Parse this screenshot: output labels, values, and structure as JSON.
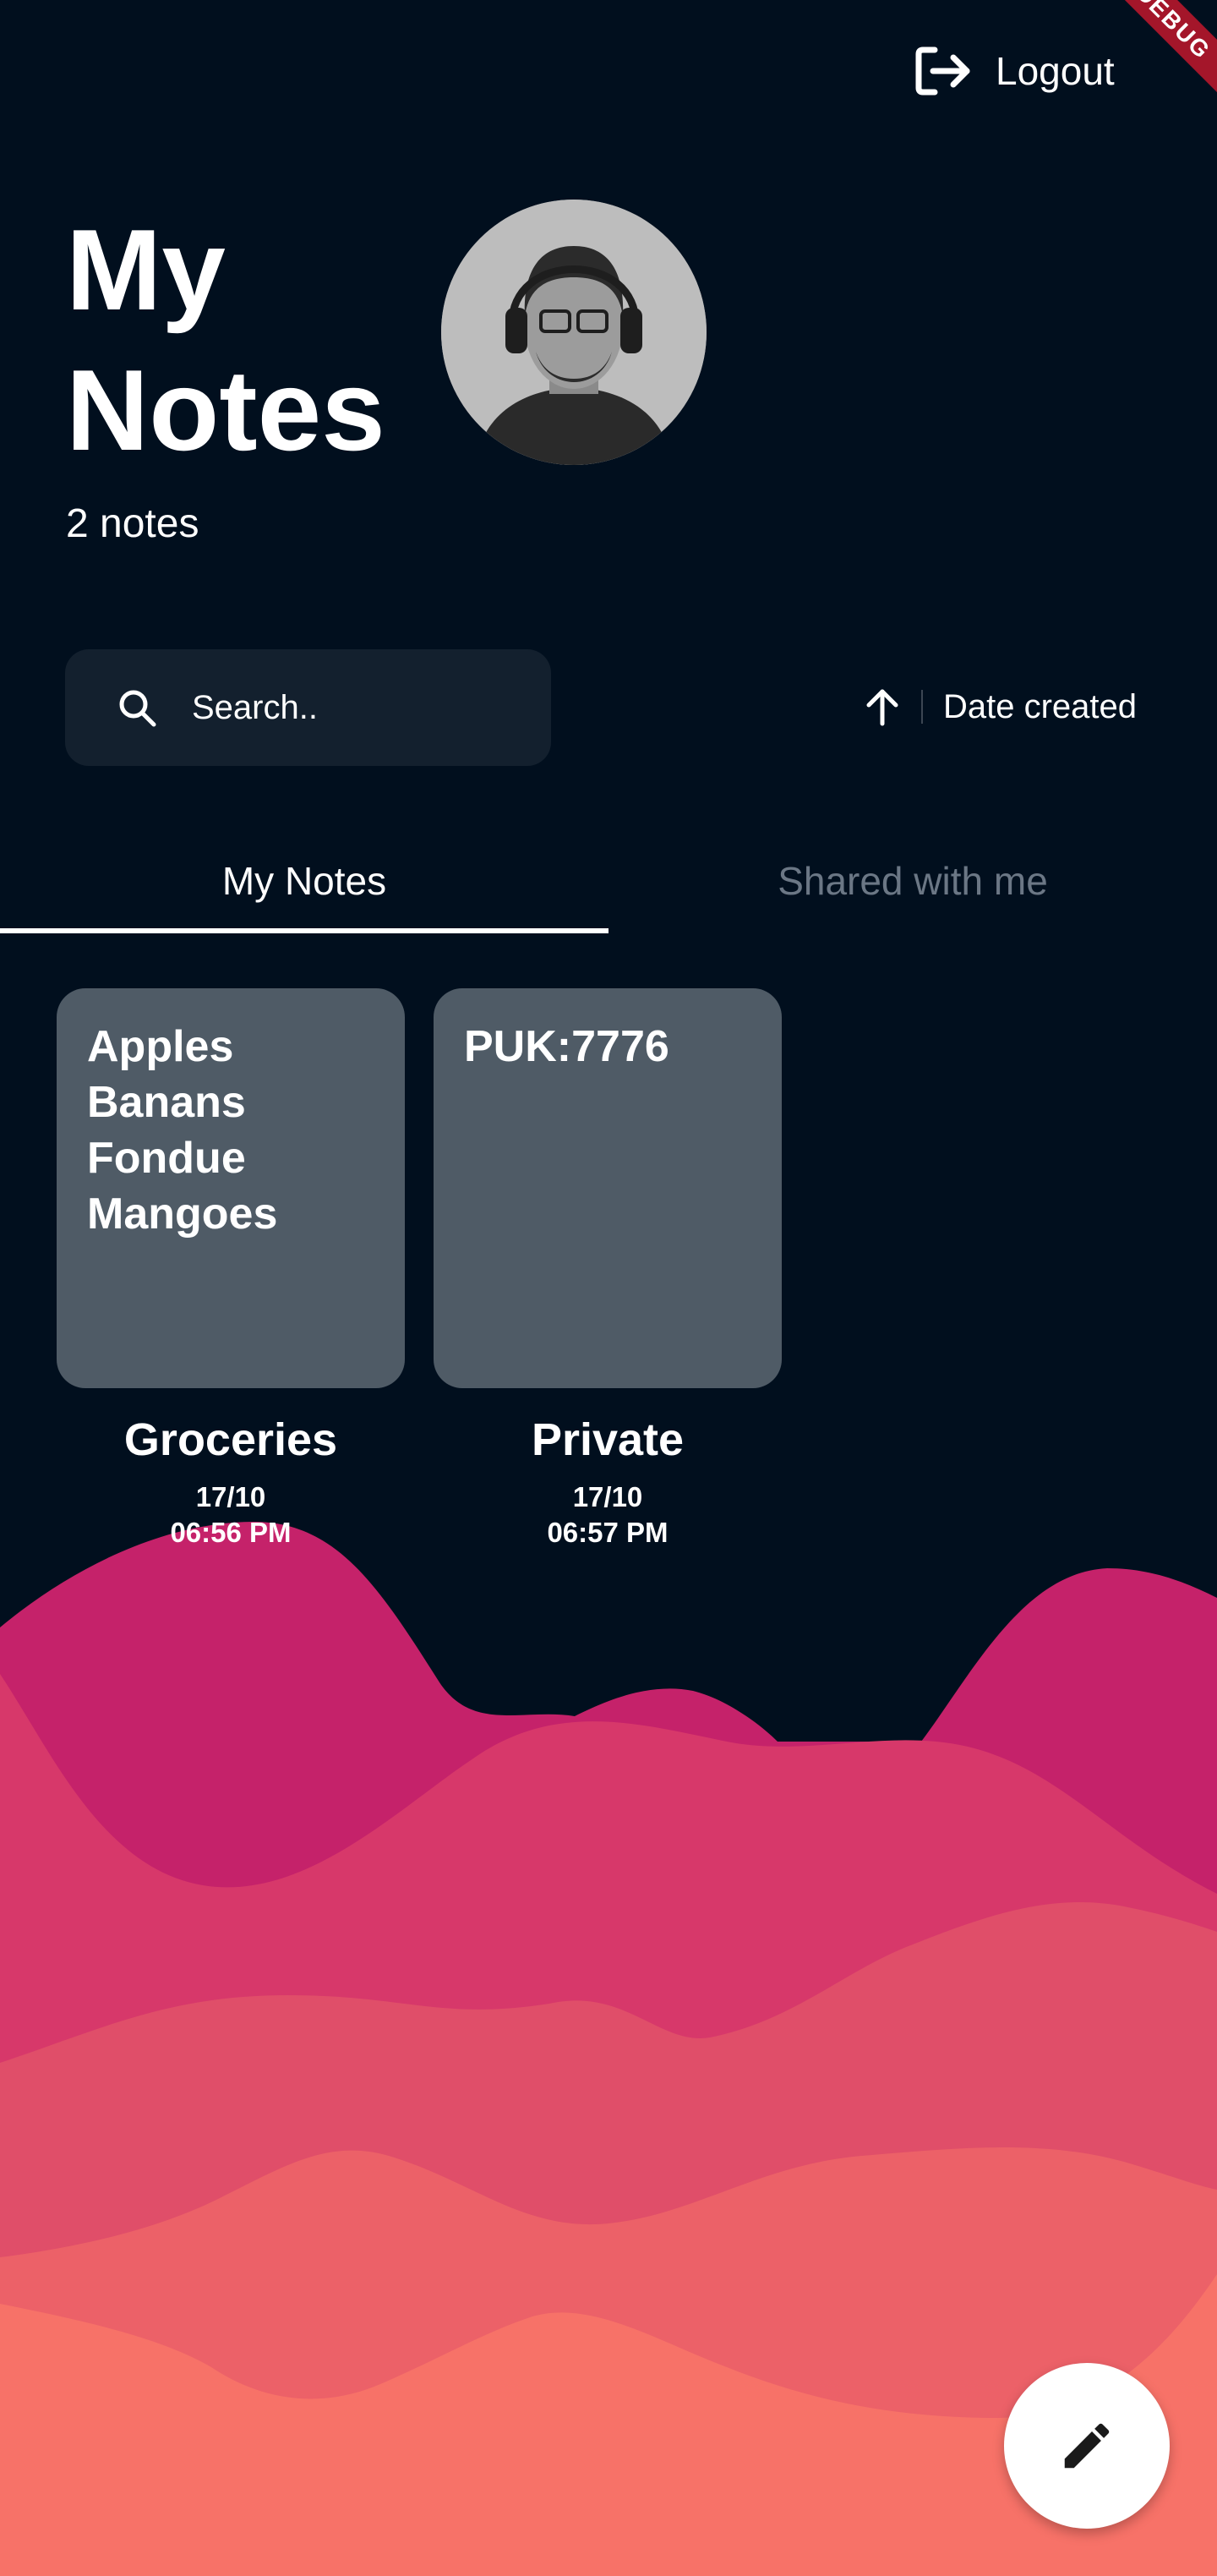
{
  "debug_banner": "DEBUG",
  "header": {
    "logout_icon": "logout-icon",
    "logout_label": "Logout",
    "title": "My Notes",
    "avatar_icon": "avatar-photo",
    "note_count": "2 notes"
  },
  "search": {
    "icon": "search-icon",
    "placeholder": "Search.."
  },
  "sort": {
    "icon": "arrow-up-icon",
    "label": "Date created"
  },
  "tabs": [
    {
      "label": "My Notes",
      "active": true
    },
    {
      "label": "Shared with me",
      "active": false
    }
  ],
  "notes": [
    {
      "content": "Apples\nBanans\nFondue\nMangoes",
      "title": "Groceries",
      "date": "17/10",
      "time": "06:56 PM"
    },
    {
      "content": "PUK:7776",
      "title": "Private",
      "date": "17/10",
      "time": "06:57 PM"
    }
  ],
  "fab": {
    "icon": "pencil-icon"
  },
  "colors": {
    "background": "#010f1e",
    "card": "#4f5b66",
    "search_bg": "#13202e",
    "wave_1": "#c5226a",
    "wave_2": "#d7386a",
    "wave_3": "#e04e69",
    "wave_4": "#ec6168",
    "wave_5": "#f77268",
    "debug_banner": "#a4162a"
  }
}
